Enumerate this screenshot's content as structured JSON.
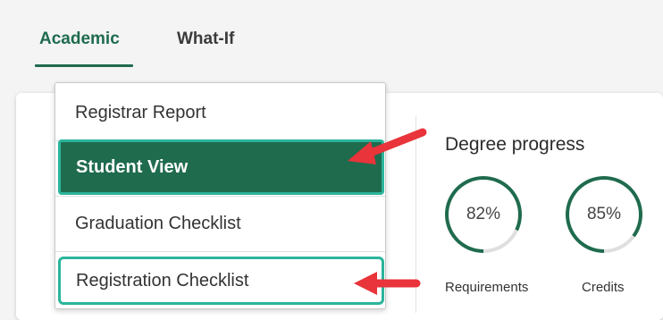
{
  "tabs": [
    {
      "label": "Academic",
      "active": true
    },
    {
      "label": "What-If",
      "active": false
    }
  ],
  "menu": {
    "items": [
      {
        "label": "Registrar Report"
      },
      {
        "label": "Student View"
      },
      {
        "label": "Graduation Checklist"
      },
      {
        "label": "Registration Checklist"
      }
    ],
    "selected_index": 1
  },
  "degree_progress": {
    "title": "Degree progress",
    "requirements": {
      "value": "82%",
      "label": "Requirements",
      "fraction": 0.82
    },
    "credits": {
      "value": "85%",
      "label": "Credits",
      "fraction": 0.85
    }
  },
  "colors": {
    "brand_green": "#1f6b4e",
    "highlight_teal": "#2bb59b",
    "annotation_red": "#e8343a"
  }
}
